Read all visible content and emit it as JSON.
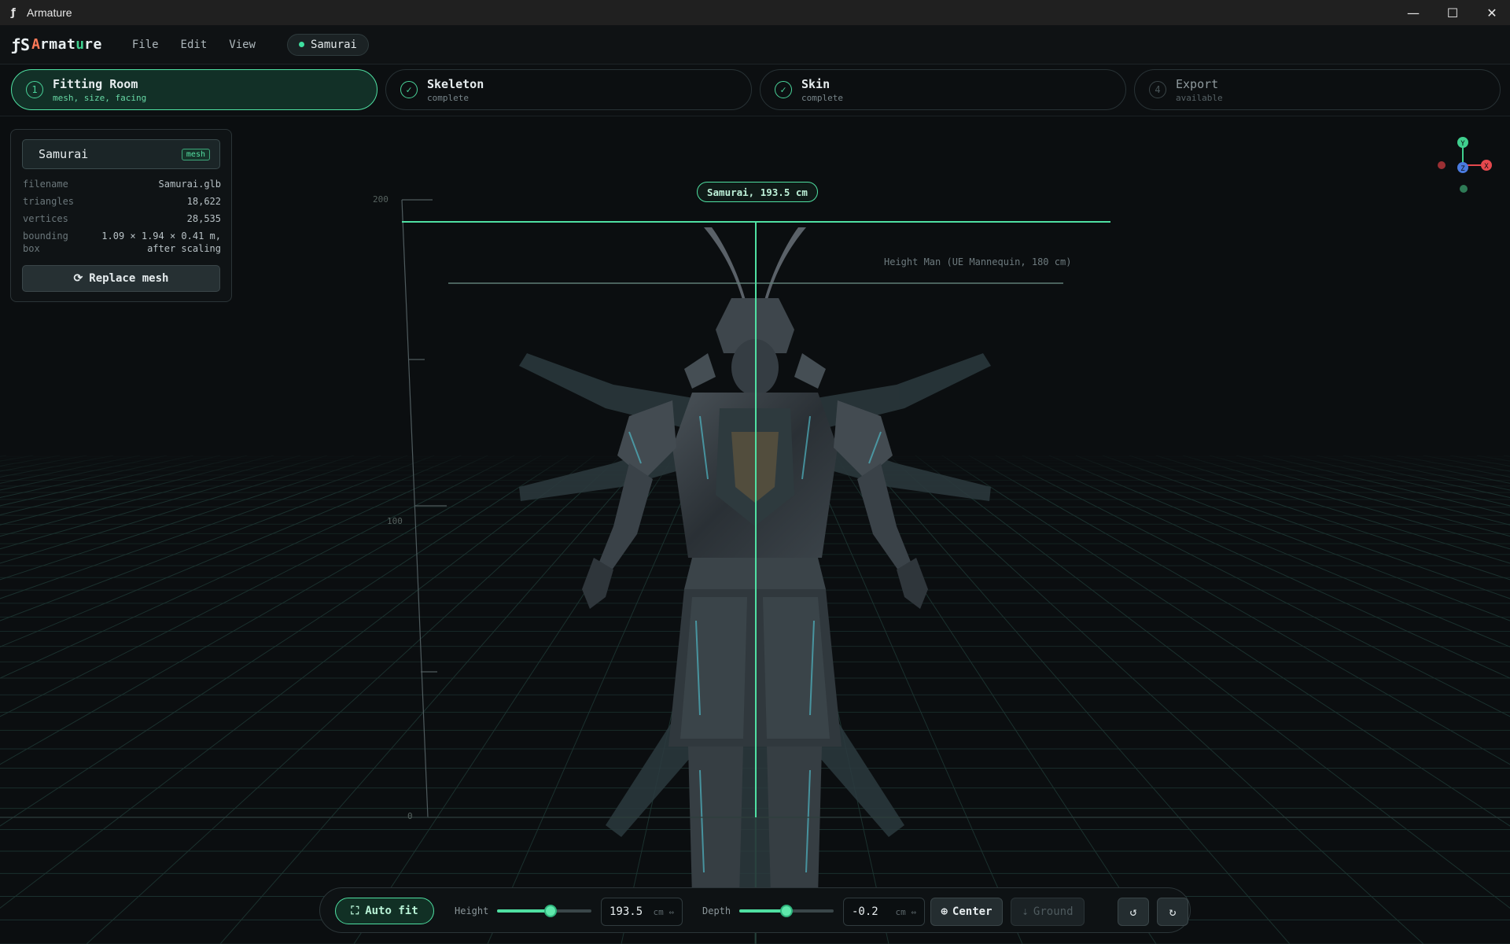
{
  "window": {
    "title": "Armature",
    "app_icon": "armature-logo-icon",
    "minimize_glyph": "—",
    "maximize_glyph": "☐",
    "close_glyph": "✕"
  },
  "menubar": {
    "logo": {
      "mark": "ƒS",
      "a": "A",
      "rest": "rmat",
      "accent": "u",
      "end": "re"
    },
    "items": [
      "File",
      "Edit",
      "View"
    ],
    "document_chip": "Samurai"
  },
  "steps": [
    {
      "num": "1",
      "name": "Fitting Room",
      "sub": "mesh, size, facing",
      "state": "active"
    },
    {
      "num": "✓",
      "name": "Skeleton",
      "sub": "complete",
      "state": "done"
    },
    {
      "num": "✓",
      "name": "Skin",
      "sub": "complete",
      "state": "done"
    },
    {
      "num": "4",
      "name": "Export",
      "sub": "available",
      "state": "available"
    }
  ],
  "mesh_panel": {
    "name": "Samurai",
    "badge": "mesh",
    "rows": [
      {
        "k": "filename",
        "v": "Samurai.glb"
      },
      {
        "k": "triangles",
        "v": "18,622"
      },
      {
        "k": "vertices",
        "v": "28,535"
      },
      {
        "k": "bounding",
        "v": "1.09 × 1.94 × 0.41 m,"
      },
      {
        "k": "box",
        "v": "after scaling"
      }
    ],
    "replace_button": "Replace mesh"
  },
  "viewport": {
    "height_tag": "Samurai, 193.5 cm",
    "reference_label": "Height Man (UE Mannequin, 180 cm)",
    "ruler_labels": [
      "200",
      "100",
      "0"
    ],
    "gizmo": {
      "y": "Y",
      "x": "X",
      "z": "Z"
    }
  },
  "toolbar": {
    "auto_fit": "Auto fit",
    "height_label": "Height",
    "height_value": "193.5",
    "height_unit": "cm ⇔",
    "height_level": 0.57,
    "depth_label": "Depth",
    "depth_value": "-0.2",
    "depth_unit": "cm ⇔",
    "depth_level": 0.5,
    "center_button": "Center",
    "ground_button": "Ground",
    "undo_icon": "undo-icon",
    "redo_icon": "redo-icon"
  },
  "colors": {
    "accent": "#4fe0a2",
    "background": "#0b0e10",
    "grid": "#1f3a36",
    "axis_x": "#e5484d",
    "axis_y": "#3fcf8e",
    "axis_z": "#4a7be0"
  }
}
